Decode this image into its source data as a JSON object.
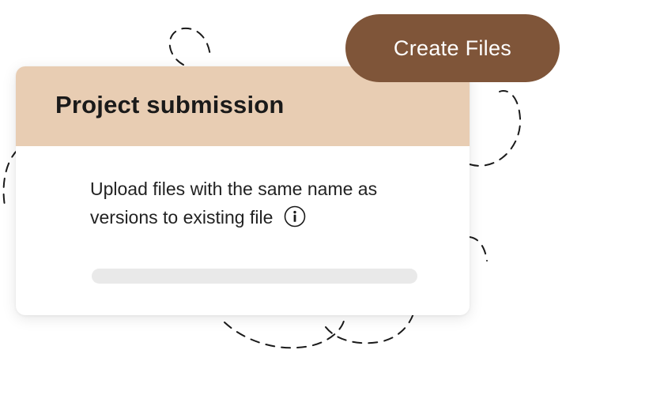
{
  "card": {
    "title": "Project submission",
    "description": "Upload files with the same name as versions to existing file",
    "info_icon": "info-circle-icon",
    "upload_progress": 0
  },
  "actions": {
    "create_files_label": "Create Files"
  },
  "colors": {
    "header_bg": "#e8cdb3",
    "accent_brown": "#7f5539",
    "progress_track": "#e9e9e9",
    "button_text": "#ffffff"
  }
}
